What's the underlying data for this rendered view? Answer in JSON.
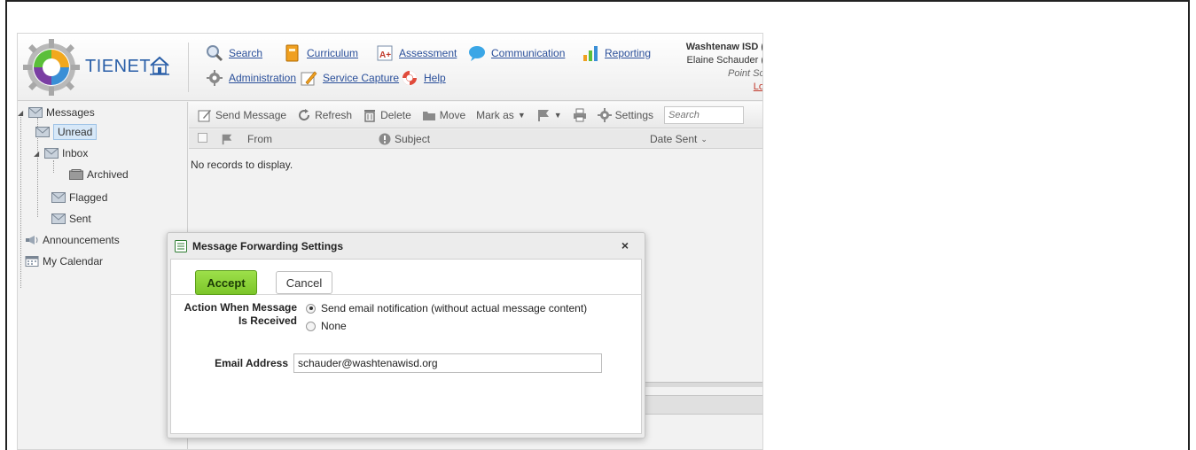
{
  "header": {
    "brand": "TIENET",
    "nav": {
      "search": "Search",
      "curriculum": "Curriculum",
      "assessment": "Assessment",
      "communication": "Communication",
      "reporting": "Reporting",
      "administration": "Administration",
      "service_capture": "Service Capture",
      "help": "Help"
    },
    "user": {
      "org": "Washtenaw ISD (",
      "name": "Elaine Schauder (",
      "school": "Point Sc",
      "logout": "Lo"
    }
  },
  "sidebar": {
    "items": [
      {
        "label": "Messages"
      },
      {
        "label": "Unread"
      },
      {
        "label": "Inbox"
      },
      {
        "label": "Archived"
      },
      {
        "label": "Flagged"
      },
      {
        "label": "Sent"
      },
      {
        "label": "Announcements"
      },
      {
        "label": "My Calendar"
      }
    ]
  },
  "toolbar": {
    "send_message": "Send Message",
    "refresh": "Refresh",
    "delete": "Delete",
    "move": "Move",
    "mark_as": "Mark as",
    "settings": "Settings",
    "search_placeholder": "Search"
  },
  "grid": {
    "columns": {
      "from": "From",
      "subject": "Subject",
      "date_sent": "Date Sent"
    },
    "empty_message": "No records to display."
  },
  "dialog": {
    "title": "Message Forwarding Settings",
    "close": "×",
    "accept": "Accept",
    "cancel": "Cancel",
    "action_label_line1": "Action When Message",
    "action_label_line2": "Is Received",
    "options": [
      {
        "label": "Send email notification (without actual message content)",
        "selected": true
      },
      {
        "label": "None",
        "selected": false
      }
    ],
    "email_label": "Email Address",
    "email_value": "schauder@washtenawisd.org"
  },
  "colors": {
    "accent_blue": "#2a4f9a",
    "accept_green": "#8fd43a",
    "selection_blue": "#d7e8f8"
  }
}
